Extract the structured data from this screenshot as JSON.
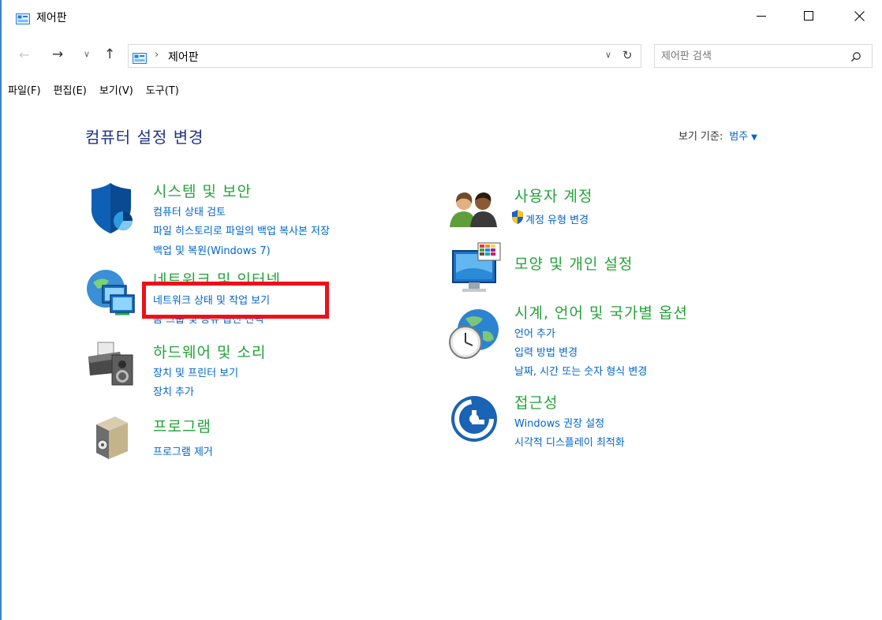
{
  "window": {
    "title": "제어판"
  },
  "nav": {
    "back": "←",
    "forward": "→",
    "recent": "∨",
    "up": "↑"
  },
  "address": {
    "crumb_sep": "›",
    "crumb": "제어판",
    "dropdown": "∨",
    "refresh": "↻"
  },
  "search": {
    "placeholder": "제어판 검색"
  },
  "menu": [
    "파일(F)",
    "편집(E)",
    "보기(V)",
    "도구(T)"
  ],
  "page_title": "컴퓨터 설정 변경",
  "view_by": {
    "label": "보기 기준:",
    "value": "범주",
    "arrow": "▼"
  },
  "categories": {
    "system": {
      "title": "시스템 및 보안",
      "links": [
        "컴퓨터 상태 검토",
        "파일 히스토리로 파일의 백업 복사본 저장",
        "백업 및 복원(Windows 7)"
      ]
    },
    "network": {
      "title": "네트워크 및 인터넷",
      "links": [
        "네트워크 상태 및 작업 보기",
        "홈 그룹 및 공유 옵션 선택"
      ]
    },
    "hardware": {
      "title": "하드웨어 및 소리",
      "links": [
        "장치 및 프린터 보기",
        "장치 추가"
      ]
    },
    "programs": {
      "title": "프로그램",
      "links": [
        "프로그램 제거"
      ]
    },
    "users": {
      "title": "사용자 계정",
      "links": [
        "계정 유형 변경"
      ]
    },
    "appearance": {
      "title": "모양 및 개인 설정",
      "links": []
    },
    "clock": {
      "title": "시계, 언어 및 국가별 옵션",
      "links": [
        "언어 추가",
        "입력 방법 변경",
        "날짜, 시간 또는 숫자 형식 변경"
      ]
    },
    "access": {
      "title": "접근성",
      "links": [
        "Windows 권장 설정",
        "시각적 디스플레이 최적화"
      ]
    }
  },
  "colors": {
    "accent_link": "#0066cc",
    "category_title": "#26a23a",
    "page_title": "#1e3287",
    "highlight": "#ef0f18"
  }
}
